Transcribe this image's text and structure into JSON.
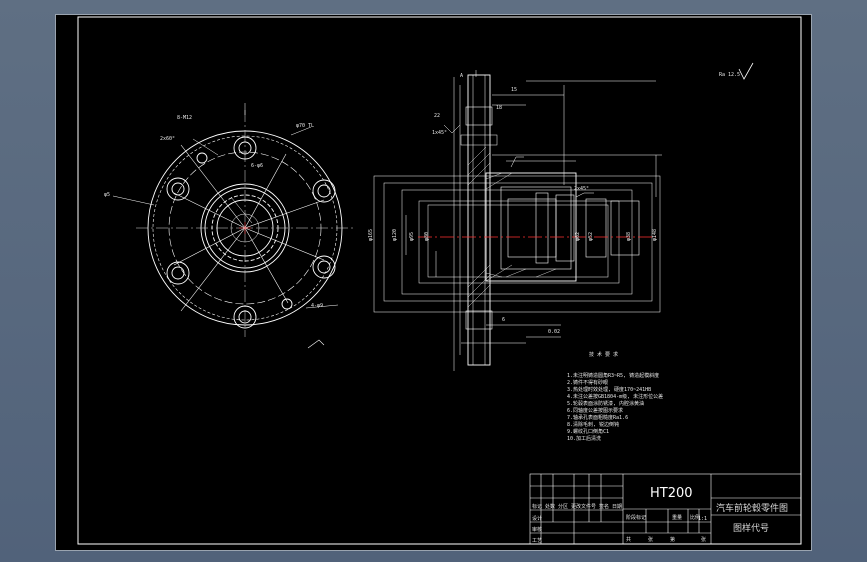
{
  "drawing": {
    "material": "HT200",
    "part_title": "汽车前轮毂零件图",
    "drawing_code_label": "图样代号",
    "scale": "1:1",
    "tech_requirements_title": "技 术 要 求",
    "tech_requirements": [
      "1.未注明铸造圆角R3~R5, 铸造起模斜度",
      "2.铸件不得有砂眼",
      "3.热处理时效处理, 硬度170~241HB",
      "4.未注公差按GB1804-m级, 未注形位公差",
      "5.轮毂表面涂防锈漆, 内腔涂黄油",
      "6.同轴度公差按图示要求",
      "7.轴承孔表面粗糙度Ra1.6",
      "8.清除毛刺, 锐边倒钝",
      "9.螺纹孔口倒角C1",
      "10.加工后清洗"
    ],
    "title_block_row_labels": [
      "标记 处数 分区 更改文件号 签名 日期",
      "设计",
      "审核",
      "工艺"
    ],
    "title_block_col_labels": [
      "阶段标记",
      "重量",
      "比例"
    ],
    "title_block_bottom_labels": [
      "共",
      "张",
      "第",
      "张"
    ],
    "ann_front": [
      "2x60°",
      "8-M12",
      "4-φ9",
      "φ5",
      "6-φ6",
      "φ70 TL"
    ],
    "ann_section": [
      "φ165",
      "φ120",
      "φ95",
      "φ80",
      "φ62",
      "φ52",
      "φ38",
      "φ148",
      "15",
      "18",
      "22",
      "6",
      "1x45°",
      "2x45°",
      "0.02",
      "A"
    ],
    "roughness_mark": "Ra 12.5"
  }
}
